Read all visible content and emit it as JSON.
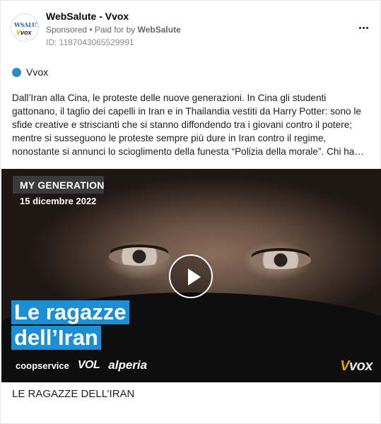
{
  "header": {
    "page_name": "WebSalute - Vvox",
    "sponsored": "Sponsored",
    "paid_prefix": " • Paid for by ",
    "paid_by": "WebSalute",
    "ad_id": "ID: 1187043065529991",
    "avatar_logo_top": "WSALUTE",
    "avatar_logo_bottom": "Vvox"
  },
  "platform": {
    "label": "Vvox",
    "icon": "platform-dot-icon",
    "color": "#2d88c6"
  },
  "body_lines": [
    "Dall’Iran alla Cina, le proteste delle nuove generazioni. In Cina gli studenti",
    "gattonano, il taglio dei capelli in Iran e in Thailandia vestiti da Harry Potter: sono le",
    "sfide creative e striscianti che si stanno diffondendo tra i giovani contro il potere;",
    "mentre si susseguono le proteste sempre più dure in Iran contro il regime,",
    "nonostante si annunci lo scioglimento della funesta “Polizia della morale”. Chi ha…"
  ],
  "media": {
    "series_title": "MY GENERATION",
    "date": "15 dicembre 2022",
    "title_line_1": "Le ragazze",
    "title_line_2": "dell’Iran",
    "sponsors": [
      "coopservice",
      "VOL",
      "alperia"
    ],
    "brand": "Vvox",
    "accent_color": "#1a8fd6"
  },
  "link_title": "LE RAGAZZE DELL’IRAN"
}
